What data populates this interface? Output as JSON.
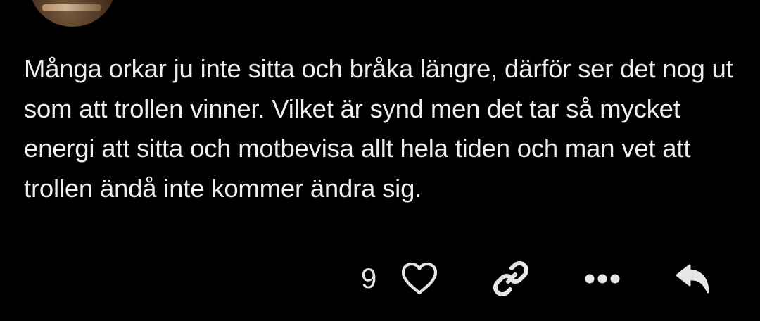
{
  "post": {
    "text": "Många orkar ju inte sitta och bråka längre, därför ser det nog ut som att trollen vinner. Vilket är synd men det tar så mycket energi att sitta och motbevisa allt hela tiden och man vet att trollen ändå inte kommer ändra sig.",
    "like_count": "9"
  },
  "icons": {
    "like": "heart-outline-icon",
    "share": "link-icon",
    "more": "ellipsis-icon",
    "reply": "reply-arrow-icon"
  },
  "colors": {
    "background": "#000000",
    "text": "#efefef",
    "icon": "#e6e6e6"
  }
}
